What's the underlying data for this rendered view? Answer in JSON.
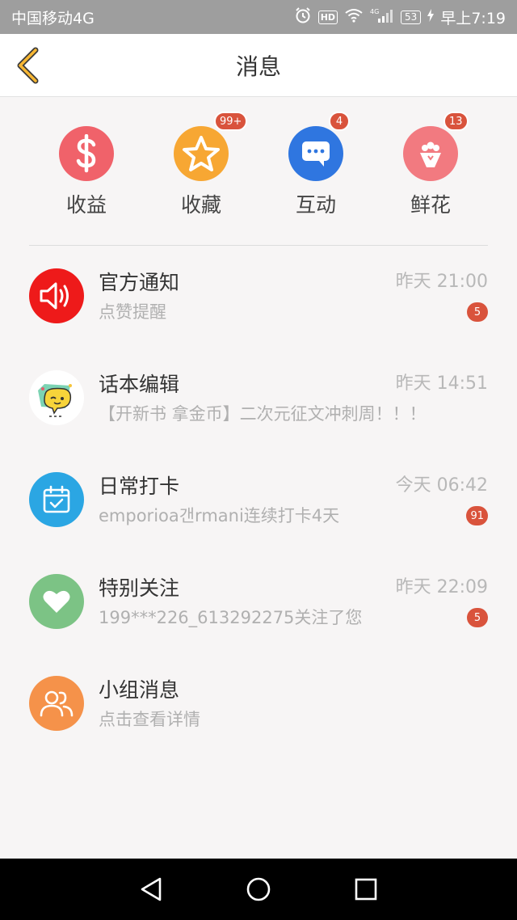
{
  "status_bar": {
    "carrier": "中国移动4G",
    "network": "4G",
    "battery": "53",
    "time": "早上7:19"
  },
  "header": {
    "title": "消息"
  },
  "quick": [
    {
      "label": "收益",
      "icon": "dollar-icon",
      "color": "#f0626a",
      "badge": ""
    },
    {
      "label": "收藏",
      "icon": "star-icon",
      "color": "#f7a733",
      "badge": "99+"
    },
    {
      "label": "互动",
      "icon": "chat-icon",
      "color": "#2f76e0",
      "badge": "4"
    },
    {
      "label": "鲜花",
      "icon": "flower-icon",
      "color": "#f27a80",
      "badge": "13"
    }
  ],
  "messages": [
    {
      "title": "官方通知",
      "time": "昨天 21:00",
      "preview": "点赞提醒",
      "badge": "5",
      "icon": "speaker-icon",
      "color": "#ee1a1a"
    },
    {
      "title": "话本编辑",
      "time": "昨天 14:51",
      "preview": "【开新书 拿金币】二次元征文冲刺周！！！",
      "badge": "",
      "icon": "editor-avatar",
      "color": "#ffffff"
    },
    {
      "title": "日常打卡",
      "time": "今天 06:42",
      "preview": "emporioa갠rmani连续打卡4天",
      "badge": "91",
      "icon": "calendar-icon",
      "color": "#2ba6e3"
    },
    {
      "title": "特别关注",
      "time": "昨天 22:09",
      "preview": "199***226_613292275关注了您",
      "badge": "5",
      "icon": "heart-icon",
      "color": "#7cc385"
    },
    {
      "title": "小组消息",
      "time": "",
      "preview": "点击查看详情",
      "badge": "",
      "icon": "group-icon",
      "color": "#f5924a"
    }
  ]
}
